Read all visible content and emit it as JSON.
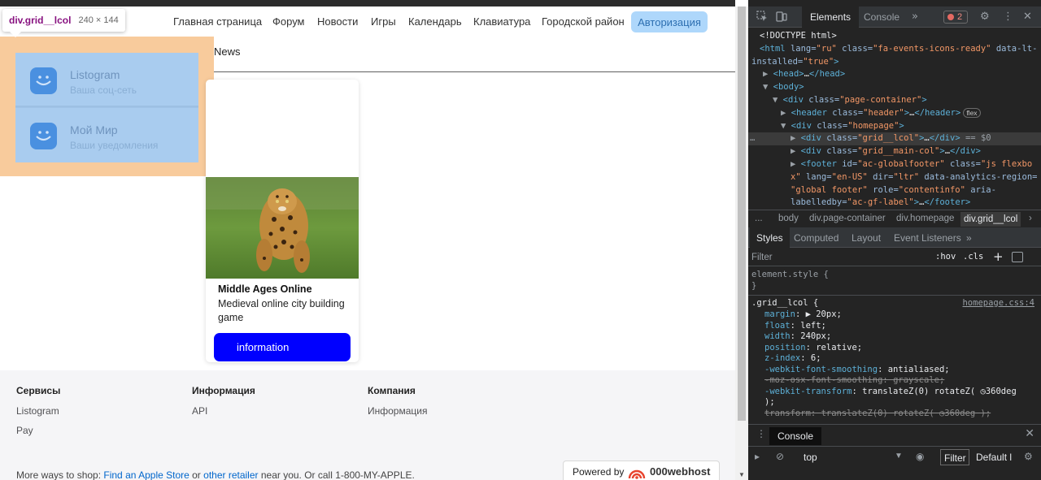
{
  "nav": {
    "items": [
      "Главная страница",
      "Форум",
      "Новости",
      "Игры",
      "Календарь",
      "Клавиатура",
      "Городской район"
    ],
    "auth_label": "Авторизация"
  },
  "inspect_tooltip": {
    "element": "div.grid__lcol",
    "size": "240 × 144"
  },
  "left_col": {
    "items": [
      {
        "title": "Listogram",
        "subtitle": "Ваша соц-сеть"
      },
      {
        "title": "Мой Мир",
        "subtitle": "Ваши уведомления"
      }
    ]
  },
  "main": {
    "section_label": "News",
    "card": {
      "title": "Middle Ages Online",
      "description": "Medieval online city building game",
      "button_label": "information"
    }
  },
  "footer": {
    "columns": [
      {
        "title": "Сервисы",
        "links": [
          "Listogram",
          "Pay"
        ]
      },
      {
        "title": "Информация",
        "links": [
          "API"
        ]
      },
      {
        "title": "Компания",
        "links": [
          "Информация"
        ]
      }
    ],
    "ways_prefix": "More ways to shop: ",
    "ways_link1": "Find an Apple Store",
    "ways_mid": " or ",
    "ways_link2": "other retailer",
    "ways_suffix": " near you. Or call 1-800-MY-APPLE.",
    "powered_by": "Powered by",
    "powered_brand": "000webhost"
  },
  "devtools": {
    "tabs": [
      "Elements",
      "Console"
    ],
    "error_count": "2",
    "dom_lines": [
      {
        "parts": [
          [
            "t-txt",
            "<!DOCTYPE html>"
          ]
        ]
      },
      {
        "parts": [
          [
            "t-tag",
            "<html "
          ],
          [
            "t-attr",
            "lang="
          ],
          [
            "t-val",
            "\"ru\" "
          ],
          [
            "t-attr",
            "class="
          ],
          [
            "t-val",
            "\"fa-events-icons-ready\" "
          ],
          [
            "t-attr",
            "data-lt-"
          ]
        ]
      },
      {
        "parts": [
          [
            "t-attr",
            "installed="
          ],
          [
            "t-val",
            "\"true\""
          ],
          [
            "t-tag",
            ">"
          ]
        ]
      },
      {
        "parts": [
          [
            "t-gray",
            "▶ "
          ],
          [
            "t-tag",
            "<head>"
          ],
          [
            "t-txt",
            "…"
          ],
          [
            "t-tag",
            "</head>"
          ]
        ]
      },
      {
        "parts": [
          [
            "t-gray",
            "▼ "
          ],
          [
            "t-tag",
            "<body>"
          ]
        ]
      },
      {
        "parts": [
          [
            "t-gray",
            "▼ "
          ],
          [
            "t-tag",
            "<div "
          ],
          [
            "t-attr",
            "class="
          ],
          [
            "t-val",
            "\"page-container\""
          ],
          [
            "t-tag",
            ">"
          ]
        ]
      },
      {
        "parts": [
          [
            "t-gray",
            "▶ "
          ],
          [
            "t-tag",
            "<header "
          ],
          [
            "t-attr",
            "class="
          ],
          [
            "t-val",
            "\"header\""
          ],
          [
            "t-tag",
            ">"
          ],
          [
            "t-txt",
            "…"
          ],
          [
            "t-tag",
            "</header>"
          ]
        ],
        "badge": "flex"
      },
      {
        "parts": [
          [
            "t-gray",
            "▼ "
          ],
          [
            "t-tag",
            "<div "
          ],
          [
            "t-attr",
            "class="
          ],
          [
            "t-val",
            "\"homepage\""
          ],
          [
            "t-tag",
            ">"
          ]
        ]
      },
      {
        "parts": [
          [
            "t-gray",
            "▶ "
          ],
          [
            "t-tag",
            "<div "
          ],
          [
            "t-attr",
            "class="
          ],
          [
            "t-val",
            "\"grid__lcol\""
          ],
          [
            "t-tag",
            ">"
          ],
          [
            "t-txt",
            "…"
          ],
          [
            "t-tag",
            "</div>"
          ],
          [
            "t-gray",
            " == $0"
          ]
        ],
        "selected": true
      },
      {
        "parts": [
          [
            "t-gray",
            "▶ "
          ],
          [
            "t-tag",
            "<div "
          ],
          [
            "t-attr",
            "class="
          ],
          [
            "t-val",
            "\"grid__main-col\""
          ],
          [
            "t-tag",
            ">"
          ],
          [
            "t-txt",
            "…"
          ],
          [
            "t-tag",
            "</div>"
          ]
        ]
      },
      {
        "parts": [
          [
            "t-gray",
            "▶ "
          ],
          [
            "t-tag",
            "<footer "
          ],
          [
            "t-attr",
            "id="
          ],
          [
            "t-val",
            "\"ac-globalfooter\" "
          ],
          [
            "t-attr",
            "class="
          ],
          [
            "t-val",
            "\"js flexbo"
          ]
        ]
      },
      {
        "parts": [
          [
            "t-val",
            "x\" "
          ],
          [
            "t-attr",
            "lang="
          ],
          [
            "t-val",
            "\"en-US\" "
          ],
          [
            "t-attr",
            "dir="
          ],
          [
            "t-val",
            "\"ltr\" "
          ],
          [
            "t-attr",
            "data-analytics-region="
          ]
        ]
      },
      {
        "parts": [
          [
            "t-val",
            "\"global footer\" "
          ],
          [
            "t-attr",
            "role="
          ],
          [
            "t-val",
            "\"contentinfo\" "
          ],
          [
            "t-attr",
            "aria-"
          ]
        ]
      },
      {
        "parts": [
          [
            "t-attr",
            "labelledby="
          ],
          [
            "t-val",
            "\"ac-gf-label\""
          ],
          [
            "t-tag",
            ">"
          ],
          [
            "t-txt",
            "…"
          ],
          [
            "t-tag",
            "</footer>"
          ]
        ]
      }
    ],
    "breadcrumbs": [
      "...",
      "body",
      "div.page-container",
      "div.homepage",
      "div.grid__lcol"
    ],
    "subtabs": [
      "Styles",
      "Computed",
      "Layout",
      "Event Listeners"
    ],
    "filter_placeholder": "Filter",
    "hov": ":hov",
    "cls": ".cls",
    "element_style": "element.style {",
    "rule_selector": ".grid__lcol {",
    "rule_source": "homepage.css:4",
    "properties": [
      {
        "name": "margin",
        "value": "▶ 20px;"
      },
      {
        "name": "float",
        "value": "left;"
      },
      {
        "name": "width",
        "value": "240px;"
      },
      {
        "name": "position",
        "value": "relative;"
      },
      {
        "name": "z-index",
        "value": "6;"
      },
      {
        "name": "-webkit-font-smoothing",
        "value": "antialiased;"
      },
      {
        "name": "-moz-osx-font-smoothing",
        "value": "grayscale;",
        "struck": true
      },
      {
        "name": "-webkit-transform",
        "value": "translateZ(0) rotateZ( ◷360deg"
      },
      {
        "name": "",
        "value": "   );"
      },
      {
        "name": "transform",
        "value": "translateZ(0) rotateZ( ◷360deg );",
        "struck": true
      }
    ],
    "console_tab": "Console",
    "console_context": "top",
    "console_filter": "Filter",
    "console_level": "Default l"
  }
}
